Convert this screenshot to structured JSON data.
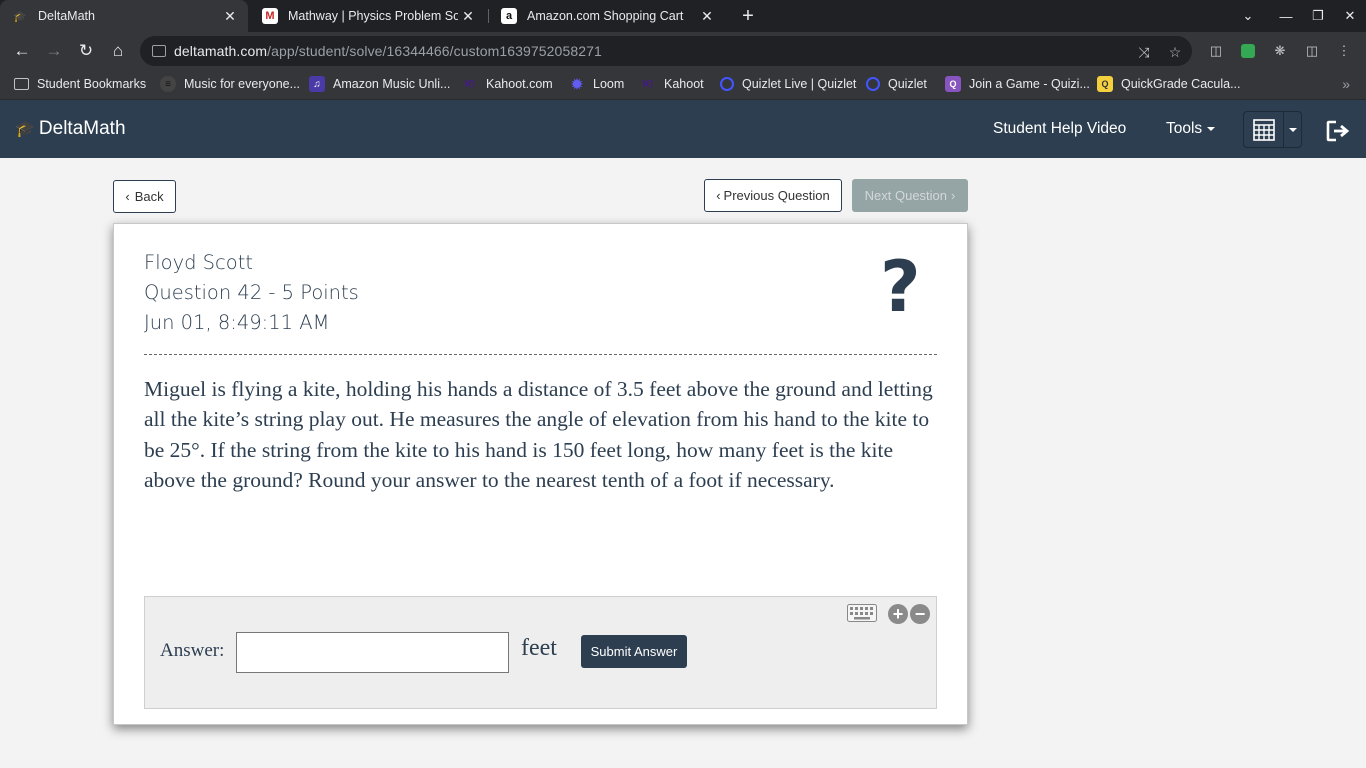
{
  "browser": {
    "tabs": [
      {
        "title": "DeltaMath",
        "favicon": "deltamath-cap-icon",
        "active": true
      },
      {
        "title": "Mathway | Physics Problem Solv",
        "favicon": "mathway-m-icon",
        "active": false
      },
      {
        "title": "Amazon.com Shopping Cart",
        "favicon": "amazon-a-icon",
        "active": false
      }
    ],
    "url_host": "deltamath.com",
    "url_path": "/app/student/solve/16344466/custom1639752058271",
    "bookmarks": [
      {
        "label": "Student Bookmarks",
        "icon": "folder-icon"
      },
      {
        "label": "Music for everyone...",
        "icon": "spotify-icon"
      },
      {
        "label": "Amazon Music Unli...",
        "icon": "amazon-music-icon"
      },
      {
        "label": "Kahoot.com",
        "icon": "kahoot-icon"
      },
      {
        "label": "Loom",
        "icon": "loom-icon"
      },
      {
        "label": "Kahoot",
        "icon": "kahoot-icon"
      },
      {
        "label": "Quizlet Live | Quizlet",
        "icon": "quizlet-icon"
      },
      {
        "label": "Quizlet",
        "icon": "quizlet-icon"
      },
      {
        "label": "Join a Game - Quizi...",
        "icon": "quizizz-icon"
      },
      {
        "label": "QuickGrade Cacula...",
        "icon": "quickgrade-icon"
      }
    ]
  },
  "nav": {
    "brand": "DeltaMath",
    "help_video": "Student Help Video",
    "tools": "Tools"
  },
  "controls": {
    "back": "Back",
    "previous": "Previous Question",
    "next": "Next Question"
  },
  "question": {
    "student": "Floyd Scott",
    "header": "Question 42 - 5 Points",
    "timestamp": "Jun 01, 8:49:11 AM",
    "help_symbol": "?",
    "text": "Miguel is flying a kite, holding his hands a distance of 3.5 feet above the ground and letting all the kite’s string play out. He measures the angle of elevation from his hand to the kite to be 25°. If the string from the kite to his hand is 150 feet long, how many feet is the kite above the ground? Round your answer to the nearest tenth of a foot if necessary."
  },
  "answer": {
    "label": "Answer:",
    "value": "",
    "unit": "feet",
    "submit": "Submit Answer"
  },
  "colors": {
    "navy": "#2c3e50",
    "chrome_dark": "#202124",
    "chrome_toolbar": "#35363a",
    "disabled_button": "#95a5a6"
  }
}
